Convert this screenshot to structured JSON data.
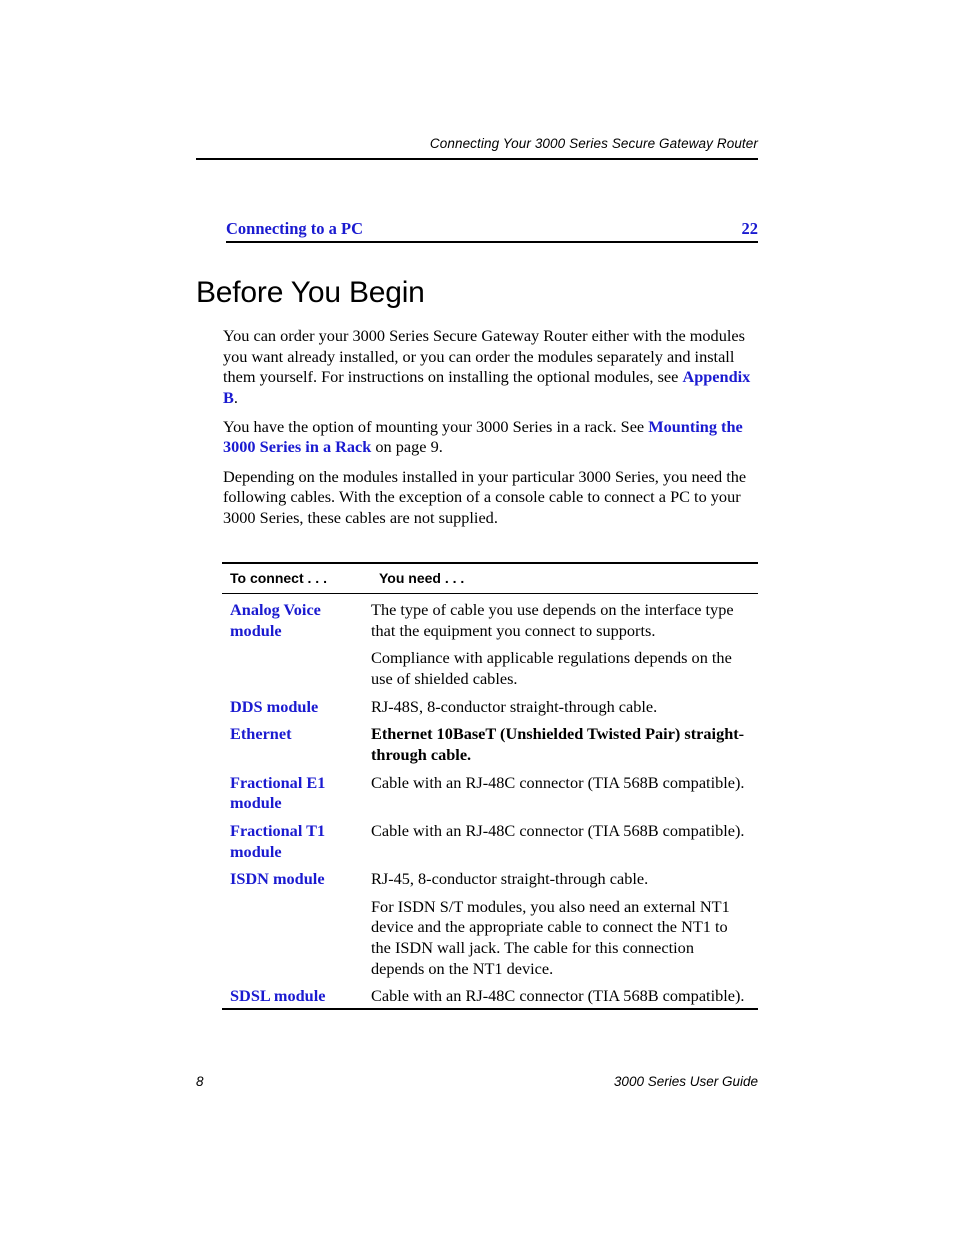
{
  "header": {
    "running_title": "Connecting Your 3000 Series Secure Gateway Router"
  },
  "xref": {
    "link_label": "Connecting to a PC",
    "page_number": "22"
  },
  "heading": {
    "title": "Before You Begin"
  },
  "paragraphs": {
    "p1_a": "You can order your 3000 Series Secure Gateway Router either with the modules you want already installed, or you can order the modules separately and install them yourself. For instructions on installing the optional modules, see ",
    "p1_link": "Appendix B",
    "p1_b": ".",
    "p2_a": "You have the option of mounting your 3000 Series in a rack. See ",
    "p2_link": "Mounting the 3000 Series in a Rack",
    "p2_b": " on page 9.",
    "p3": "Depending on the modules installed in your particular 3000 Series, you need the following cables. With the exception of a console cable to connect a PC to your 3000 Series, these cables are not supplied."
  },
  "table": {
    "headers": [
      "To connect . . .",
      "You need . . ."
    ],
    "rows": [
      {
        "key": "Analog Voice module",
        "values": [
          "The type of cable you use depends on the interface type that the equipment you connect to supports.",
          "Compliance with applicable regulations depends on the use of shielded cables."
        ],
        "bold": false
      },
      {
        "key": "DDS module",
        "values": [
          "RJ-48S, 8-conductor straight-through cable."
        ],
        "bold": false
      },
      {
        "key": "Ethernet",
        "values": [
          "Ethernet 10BaseT (Unshielded Twisted Pair) straight-through cable."
        ],
        "bold": true
      },
      {
        "key": "Fractional E1 module",
        "values": [
          "Cable with an RJ-48C connector (TIA 568B compatible)."
        ],
        "bold": false
      },
      {
        "key": "Fractional T1 module",
        "values": [
          "Cable with an RJ-48C connector (TIA 568B compatible)."
        ],
        "bold": false
      },
      {
        "key": "ISDN module",
        "values": [
          "RJ-45, 8-conductor straight-through cable.",
          "For ISDN S/T modules, you also need an external NT1 device and the appropriate cable to connect the NT1 to the ISDN wall jack. The cable for this connection depends on the NT1 device."
        ],
        "bold": false
      },
      {
        "key": "SDSL module",
        "values": [
          "Cable with an RJ-48C connector (TIA 568B compatible)."
        ],
        "bold": false
      }
    ]
  },
  "footer": {
    "page_number": "8",
    "document_title": "3000 Series User Guide"
  },
  "colors": {
    "link_blue": "#1a1ad0",
    "text_black": "#000000",
    "page_background": "#ffffff"
  }
}
